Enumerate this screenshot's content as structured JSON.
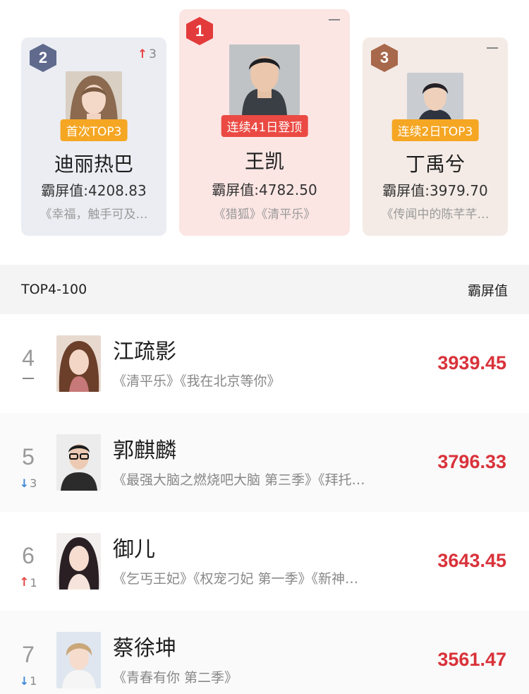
{
  "podium": [
    {
      "rank": "2",
      "trend": "up",
      "trend_value": "3",
      "streak": "首次TOP3",
      "name": "迪丽热巴",
      "score": "霸屏值:4208.83",
      "works": "《幸福，触手可及…",
      "colors": {
        "badge": "#5f6a8d",
        "card": "#ebedf3"
      }
    },
    {
      "rank": "1",
      "trend": "flat",
      "trend_value": "",
      "streak": "连续41日登顶",
      "name": "王凯",
      "score": "霸屏值:4782.50",
      "works": "《猎狐》《清平乐》",
      "colors": {
        "badge": "#e33b3b",
        "card": "#fbe6e4"
      }
    },
    {
      "rank": "3",
      "trend": "flat",
      "trend_value": "",
      "streak": "连续2日TOP3",
      "name": "丁禹兮",
      "score": "霸屏值:3979.70",
      "works": "《传闻中的陈芊芊…",
      "colors": {
        "badge": "#a8684b",
        "card": "#f4ebe6"
      }
    }
  ],
  "section": {
    "title": "TOP4-100",
    "metric": "霸屏值"
  },
  "list": [
    {
      "rank": "4",
      "trend": "flat",
      "trend_value": "",
      "name": "江疏影",
      "works": "《清平乐》《我在北京等你》",
      "score": "3939.45"
    },
    {
      "rank": "5",
      "trend": "down",
      "trend_value": "3",
      "name": "郭麒麟",
      "works": "《最强大脑之燃烧吧大脑 第三季》《拜托…",
      "score": "3796.33"
    },
    {
      "rank": "6",
      "trend": "up",
      "trend_value": "1",
      "name": "御儿",
      "works": "《乞丐王妃》《权宠刁妃 第一季》《新神…",
      "score": "3643.45"
    },
    {
      "rank": "7",
      "trend": "down",
      "trend_value": "1",
      "name": "蔡徐坤",
      "works": "《青春有你 第二季》",
      "score": "3561.47"
    }
  ],
  "icons": {
    "up": "arrow-up-icon",
    "down": "arrow-down-icon",
    "flat": "dash-icon"
  },
  "colors": {
    "score_red": "#d9323a",
    "up_red": "#e84545",
    "down_blue": "#3a86d8",
    "streak_orange": "#f5a623",
    "streak_red": "#ea4a43"
  }
}
